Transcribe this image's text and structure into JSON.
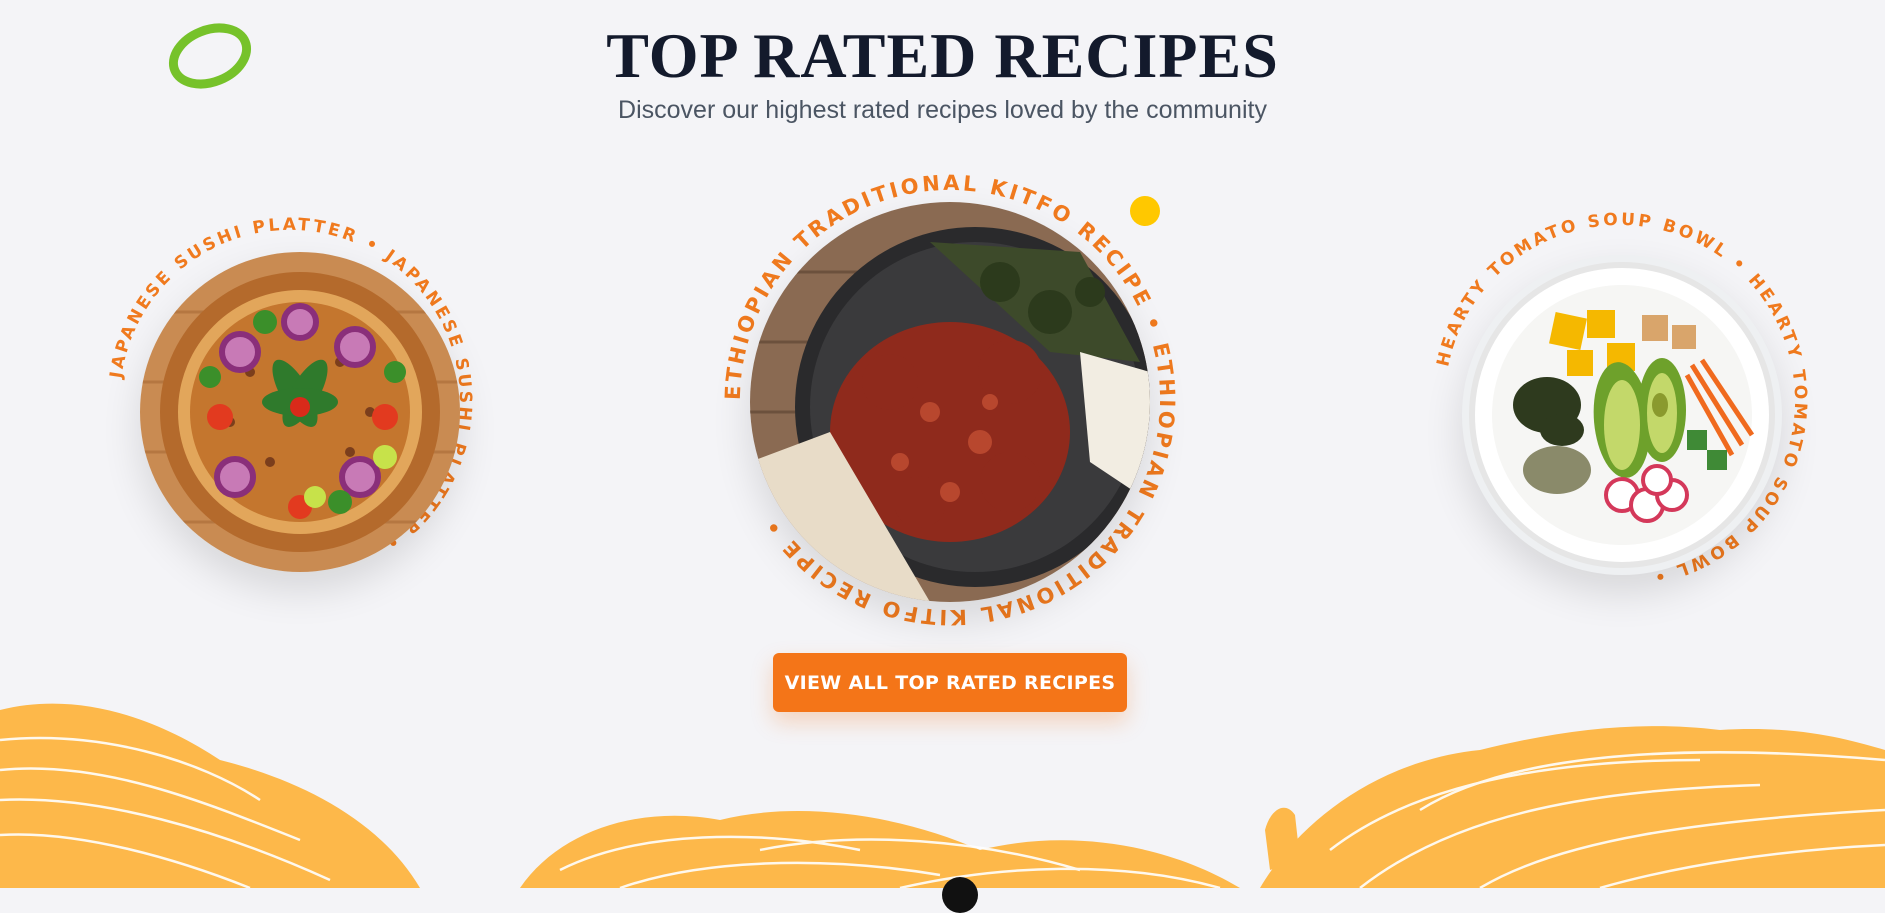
{
  "section": {
    "title": "TOP RATED RECIPES",
    "subtitle": "Discover our highest rated recipes loved by the community"
  },
  "recipes": [
    {
      "name": "JAPANESE SUSHI PLATTER",
      "ring_text": "JAPANESE SUSHI PLATTER • JAPANESE SUSHI PLATTER • "
    },
    {
      "name": "ETHIOPIAN TRADITIONAL KITFO RECIPE",
      "ring_text": "ETHIOPIAN TRADITIONAL KITFO RECIPE • ETHIOPIAN TRADITIONAL KITFO RECIPE • "
    },
    {
      "name": "HEARTY TOMATO SOUP BOWL",
      "ring_text": "HEARTY TOMATO SOUP BOWL • HEARTY TOMATO SOUP BOWL • "
    }
  ],
  "cta": {
    "label": "VIEW ALL TOP RATED RECIPES"
  },
  "colors": {
    "accent": "#f47518",
    "ring_text": "#f07a1e",
    "title": "#131a2c",
    "noodle": "#fdb84a",
    "green_ring": "#76c22a",
    "yellow_dot": "#ffc800"
  }
}
